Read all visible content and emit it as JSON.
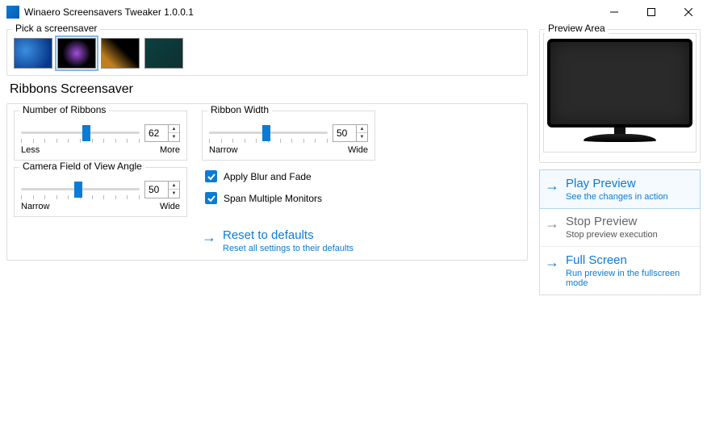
{
  "window": {
    "title": "Winaero Screensavers Tweaker 1.0.0.1"
  },
  "picker": {
    "legend": "Pick a screensaver",
    "selected": 1
  },
  "ss_title": "Ribbons Screensaver",
  "numRibbons": {
    "legend": "Number of Ribbons",
    "value": "62",
    "left": "Less",
    "right": "More",
    "pos": 55
  },
  "ribbonWidth": {
    "legend": "Ribbon Width",
    "value": "50",
    "left": "Narrow",
    "right": "Wide",
    "pos": 48
  },
  "fov": {
    "legend": "Camera Field of View Angle",
    "value": "50",
    "left": "Narrow",
    "right": "Wide",
    "pos": 48
  },
  "checks": {
    "blur": {
      "label": "Apply Blur and Fade",
      "checked": true
    },
    "span": {
      "label": "Span Multiple Monitors",
      "checked": true
    }
  },
  "reset": {
    "title": "Reset to defaults",
    "sub": "Reset all settings to their defaults"
  },
  "preview": {
    "legend": "Preview Area",
    "play": {
      "title": "Play Preview",
      "sub": "See the changes in action"
    },
    "stop": {
      "title": "Stop Preview",
      "sub": "Stop preview execution"
    },
    "full": {
      "title": "Full Screen",
      "sub": "Run preview in the fullscreen mode"
    }
  }
}
